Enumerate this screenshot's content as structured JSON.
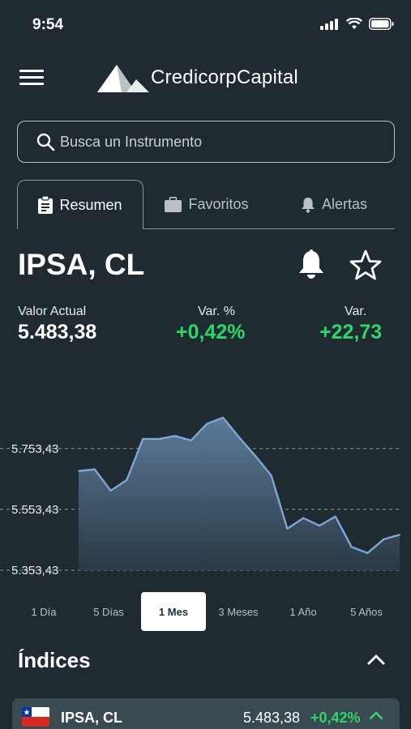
{
  "status_bar": {
    "time": "9:54"
  },
  "header": {
    "logo_text": "CredicorpCapital"
  },
  "search": {
    "placeholder": "Busca un Instrumento"
  },
  "tabs": [
    {
      "label": "Resumen",
      "icon": "clipboard-icon",
      "active": true
    },
    {
      "label": "Favoritos",
      "icon": "briefcase-icon",
      "active": false
    },
    {
      "label": "Alertas",
      "icon": "bell-icon",
      "active": false
    }
  ],
  "instrument": {
    "title": "IPSA, CL",
    "current_label": "Valor Actual",
    "current_value": "5.483,38",
    "var_pct_label": "Var. %",
    "var_pct_value": "+0,42%",
    "var_label": "Var.",
    "var_value": "+22,73"
  },
  "chart_data": {
    "type": "area",
    "y_ticks": [
      "5.753,43",
      "5.553,43",
      "5.353,43"
    ],
    "y_tick_values": [
      5753.43,
      5553.43,
      5353.43
    ],
    "ylim": [
      5353.43,
      5870
    ],
    "values": [
      5680,
      5685,
      5615,
      5650,
      5785,
      5785,
      5795,
      5780,
      5835,
      5855,
      5790,
      5730,
      5665,
      5490,
      5525,
      5500,
      5530,
      5430,
      5410,
      5455,
      5470
    ],
    "grid": "dashed horizontal",
    "color": "#7fa6d6"
  },
  "ranges": [
    {
      "label": "1 Día",
      "active": false
    },
    {
      "label": "5 Días",
      "active": false
    },
    {
      "label": "1 Mes",
      "active": true
    },
    {
      "label": "3 Meses",
      "active": false
    },
    {
      "label": "1 Año",
      "active": false
    },
    {
      "label": "5 Años",
      "active": false
    }
  ],
  "indices": {
    "title": "Índices",
    "rows": [
      {
        "name": "IPSA, CL",
        "value": "5.483,38",
        "change": "+0,42%"
      }
    ]
  }
}
